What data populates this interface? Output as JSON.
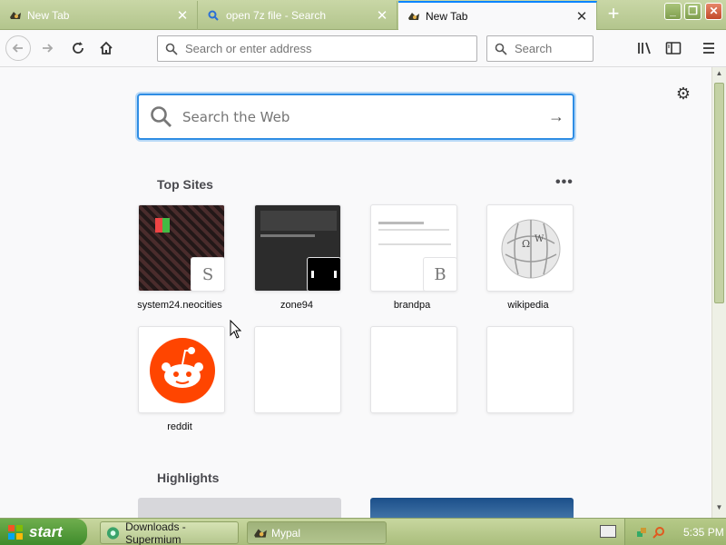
{
  "tabs": [
    {
      "title": "New Tab",
      "active": false
    },
    {
      "title": "open 7z file - Search",
      "active": false
    },
    {
      "title": "New Tab",
      "active": true
    }
  ],
  "navbar": {
    "url_placeholder": "Search or enter address",
    "search_placeholder": "Search"
  },
  "newtab": {
    "search_placeholder": "Search the Web",
    "top_sites_title": "Top Sites",
    "highlights_title": "Highlights",
    "top_sites": [
      {
        "label": "system24.neocities",
        "badge": "S"
      },
      {
        "label": "zone94",
        "badge": ""
      },
      {
        "label": "brandpa",
        "badge": "B"
      },
      {
        "label": "wikipedia",
        "badge": ""
      },
      {
        "label": "reddit",
        "badge": ""
      }
    ]
  },
  "taskbar": {
    "start_label": "start",
    "items": [
      {
        "label": "Downloads - Supermium"
      },
      {
        "label": "Mypal"
      }
    ],
    "clock": "5:35 PM"
  },
  "colors": {
    "accent": "#0a84ff",
    "reddit": "#ff4500",
    "taskbar": "#b5c78e"
  }
}
